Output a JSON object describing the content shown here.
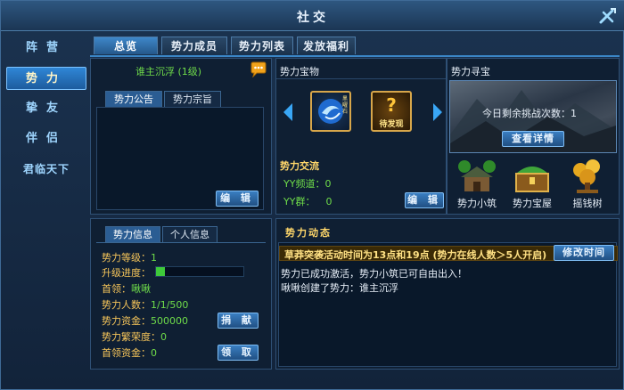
{
  "window": {
    "title": "社交"
  },
  "sidenav": {
    "items": [
      "阵营",
      "势力",
      "挚友",
      "伴侣",
      "君临天下"
    ],
    "active": 1
  },
  "tabs": [
    "总览",
    "势力成员",
    "势力列表",
    "发放福利"
  ],
  "overview": {
    "leader_line": "谁主沉浮 (1级)",
    "notice_tabs": [
      "势力公告",
      "势力宗旨"
    ],
    "edit_button": "编 辑"
  },
  "treasure": {
    "title": "势力宝物",
    "item1_label": "黑曜石",
    "item2_label": "待发现"
  },
  "exchange": {
    "title": "势力交流",
    "yy_channel_label": "YY频道：",
    "yy_channel_value": "0",
    "yy_group_label": "YY群：",
    "yy_group_value": "0",
    "edit_button": "编 辑"
  },
  "hunt": {
    "title": "势力寻宝",
    "remaining_label": "今日剩余挑战次数：",
    "remaining_value": "1",
    "details_button": "查看详情"
  },
  "buildings": [
    "势力小筑",
    "势力宝屋",
    "摇钱树"
  ],
  "info": {
    "tabs": [
      "势力信息",
      "个人信息"
    ],
    "level_label": "势力等级：",
    "level_value": "1",
    "progress_label": "升级进度：",
    "progress_fraction": 0.1,
    "leader_label": "首领：",
    "leader_value": "啾啾",
    "members_label": "势力人数：",
    "members_value": "1/1/500",
    "funds_label": "势力资金：",
    "funds_value": "500000",
    "prosperity_label": "势力繁荣度：",
    "prosperity_value": "0",
    "leader_funds_label": "首领资金：",
    "leader_funds_value": "0",
    "donate_button": "捐 献",
    "claim_button": "领 取"
  },
  "dynamics": {
    "title": "势力动态",
    "notice": "草莽突袭活动时间为13点和19点 (势力在线人数＞5人开启)",
    "modify_button": "修改时间",
    "logs": [
      "势力已成功激活，势力小筑已可自由出入！",
      "啾啾创建了势力：谁主沉浮"
    ]
  },
  "colors": {
    "accent": "#2f86d6",
    "gold": "#f6c55a",
    "green": "#6fdc4a",
    "notice_bg": "#3a2a06"
  }
}
